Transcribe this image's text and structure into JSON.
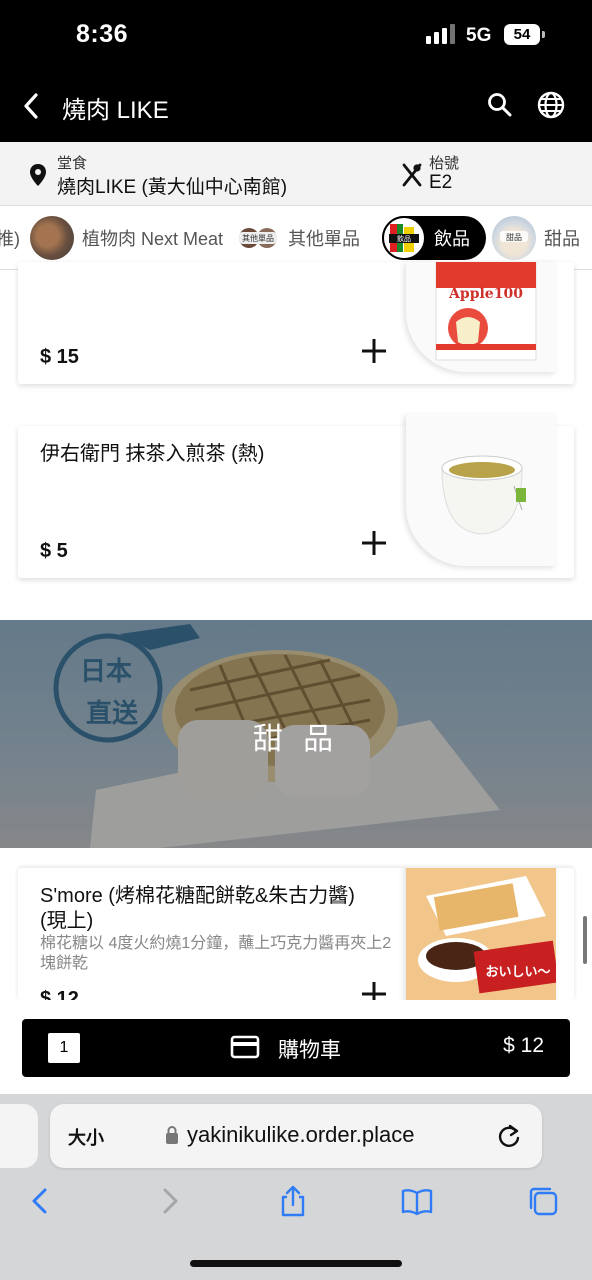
{
  "status_bar": {
    "time": "8:36",
    "network": "5G",
    "battery": "54"
  },
  "header": {
    "title": "燒肉 LIKE",
    "back_icon": "chevron-left-icon",
    "search_icon": "search-icon",
    "language_icon": "globe-icon"
  },
  "order_info": {
    "mode_label": "堂食",
    "restaurant": "燒肉LIKE (黃大仙中心南館)",
    "table_label": "枱號",
    "table_number": "E2"
  },
  "categories": [
    {
      "label": "推)"
    },
    {
      "label": "植物肉 Next Meat"
    },
    {
      "label": "其他單品",
      "thumb_text": "其他單品"
    },
    {
      "label": "飲品",
      "thumb_text": "飲品",
      "active": true
    },
    {
      "label": "甜品",
      "thumb_text": "甜品"
    }
  ],
  "items": [
    {
      "price": "$ 15",
      "photo_text": "Apple100"
    },
    {
      "name": "伊右衛門 抹茶入煎茶 (熱)",
      "price": "$ 5"
    }
  ],
  "section_banner": {
    "label": "甜 品",
    "stamp_line1": "日本",
    "stamp_line2": "直送"
  },
  "dessert_item": {
    "name": "S'more (烤棉花糖配餅乾&朱古力醬)\n(現上)",
    "description": "棉花糖以 4度火約燒1分鐘，蘸上巧克力醬再夾上2塊餅乾",
    "price": "$ 12",
    "photo_text": "おいしい〜"
  },
  "cart": {
    "count": "1",
    "label": "購物車",
    "total": "$ 12"
  },
  "browser": {
    "text_size": "大小",
    "url": "yakinikulike.order.place"
  },
  "colors": {
    "primary": "#000000",
    "background": "#ffffff",
    "muted_text": "#888888",
    "browser_bar": "#d4d6d8",
    "ios_blue": "#2f7cf6"
  }
}
